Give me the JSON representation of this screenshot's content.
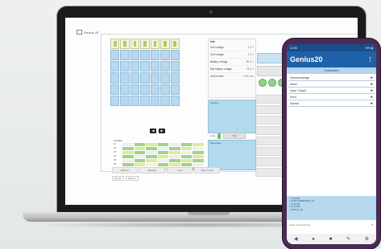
{
  "colors": {
    "phone_accent": "#1f61a8",
    "cell_blue": "#b7d8ef",
    "charged_green": "#a7cf6a",
    "panel_blue": "#b3d9ed"
  },
  "desktop": {
    "window_title": "Genius 20",
    "info_panel": {
      "heading": "Info",
      "rows": [
        {
          "label": "Cell voltage",
          "value": "4.0 V"
        },
        {
          "label": "Cell voltage",
          "value": "3.9 V"
        },
        {
          "label": "Battery voltage",
          "value": "80.0 V"
        },
        {
          "label": "Min battery voltage",
          "value": "75.0 V"
        },
        {
          "label": "Cell current",
          "value": "2000 mA"
        }
      ]
    },
    "side_buttons": [
      "Send",
      "Stop",
      ""
    ],
    "blue_box_label": "Session",
    "messages_label": "Messages",
    "toggle_label": "Auto",
    "set_button": "Set",
    "table_label": "Cell table",
    "table_rows": [
      "V1",
      "V2",
      "V3",
      "V4",
      "V5",
      "V6",
      "V7"
    ],
    "bottom_tabs": [
      "Refresh",
      "Manage",
      "Load",
      "Save to file"
    ],
    "status_tabs": [
      "Device",
      "Session"
    ],
    "ctrl_prev": "◀",
    "ctrl_next": "▶"
  },
  "phone": {
    "status_left": "12:45",
    "status_right": "75% ▮",
    "app_title": "Genius20",
    "menu_icon": "⋮",
    "parameters_label": "Parameters",
    "items": [
      "General settings",
      "Alarm",
      "Input / Output",
      "Send",
      "Special"
    ],
    "log_lines": [
      "> 11:18 PM",
      "< 22:09 CONNECTED_OK",
      "> 11:18 PM",
      "",
      "> 11:19 PM",
      "< STATUS_OK"
    ],
    "input_placeholder": "Insert command here",
    "nav_icons": [
      "◀",
      "●",
      "■",
      "✎",
      "⚙"
    ]
  }
}
